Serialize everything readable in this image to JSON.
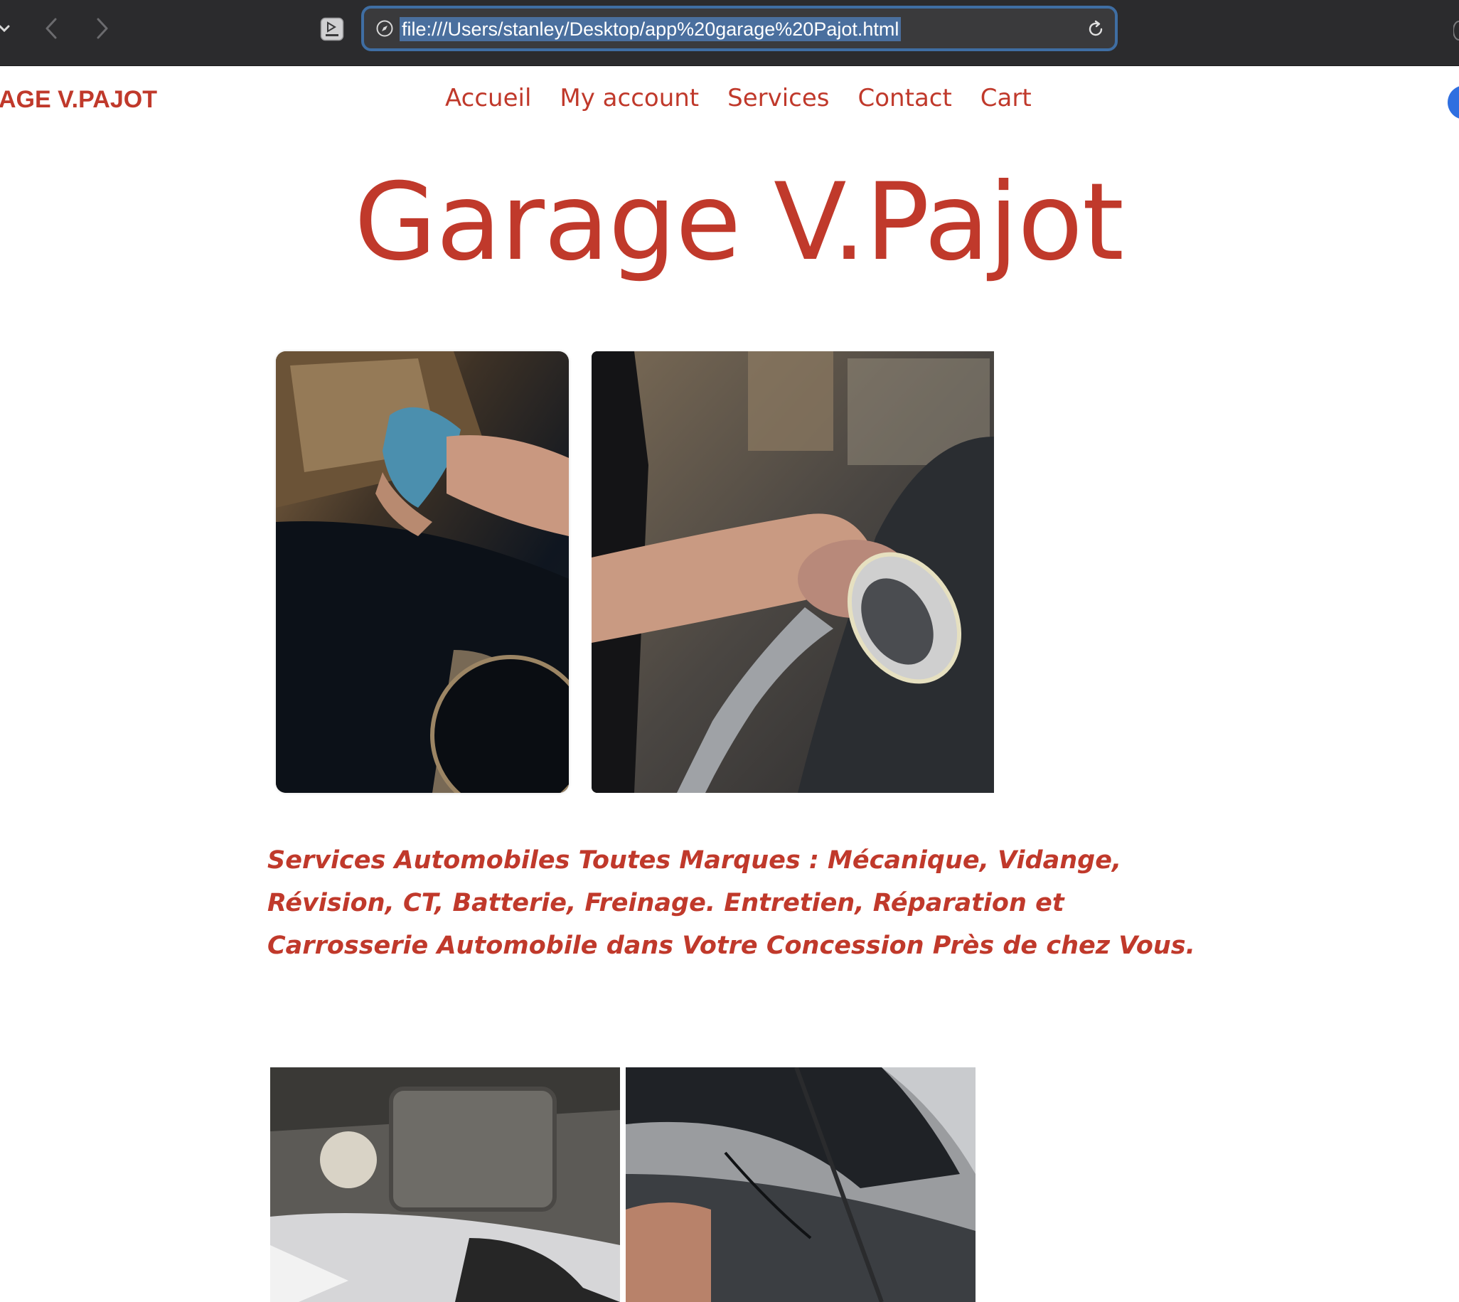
{
  "browser": {
    "url": "file:///Users/stanley/Desktop/app%20garage%20Pajot.html",
    "icons": {
      "sidebar": "chevron-down-icon",
      "back": "back-arrow-icon",
      "forward": "forward-arrow-icon",
      "reader": "reader-mode-icon",
      "site_info": "compass-icon",
      "reload": "reload-icon"
    },
    "colors": {
      "chrome_bg": "#2b2b2d",
      "address_border": "#3f6ea3",
      "url_selection": "#4a6f9e"
    }
  },
  "site": {
    "logo": "AGE V.PAJOT",
    "nav": [
      "Accueil",
      "My account",
      "Services",
      "Contact",
      "Cart"
    ],
    "hero_title": "Garage V.Pajot",
    "tagline": "Services Automobiles Toutes Marques : Mécanique, Vidange, Révision, CT, Batterie, Freinage. Entretien, Réparation et Carrosserie Automobile dans Votre Concession Près de chez Vous.",
    "accent_color": "#c0392b",
    "photos": [
      {
        "subject": "hand polishing a dark car with a blue cloth"
      },
      {
        "subject": "worker sanding car bodywork with an orbital sander"
      },
      {
        "subject": "engine bay under an open hood"
      },
      {
        "subject": "mechanic working under a raised hood"
      }
    ]
  }
}
